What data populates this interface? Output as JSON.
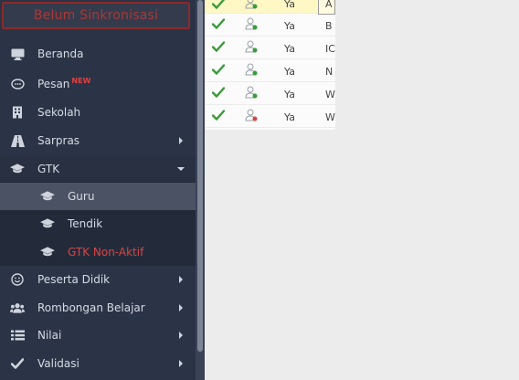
{
  "sync_status": "Belum Sinkronisasi",
  "menu": {
    "beranda": "Beranda",
    "pesan": "Pesan",
    "pesan_badge": "NEW",
    "sekolah": "Sekolah",
    "sarpras": "Sarpras",
    "gtk": "GTK",
    "guru": "Guru",
    "tendik": "Tendik",
    "gtk_nonaktif": "GTK Non-Aktif",
    "peserta_didik": "Peserta Didik",
    "rombongan_belajar": "Rombongan Belajar",
    "nilai": "Nilai",
    "validasi": "Validasi"
  },
  "table": {
    "rows": [
      {
        "status_icon": "check-icon",
        "user_icon": "user-active-icon",
        "answer": "Ya",
        "name_prefix": "A"
      },
      {
        "status_icon": "check-icon",
        "user_icon": "user-active-icon",
        "answer": "Ya",
        "name_prefix": "B"
      },
      {
        "status_icon": "check-icon",
        "user_icon": "user-active-icon",
        "answer": "Ya",
        "name_prefix": "IC"
      },
      {
        "status_icon": "check-icon",
        "user_icon": "user-active-icon",
        "answer": "Ya",
        "name_prefix": "N"
      },
      {
        "status_icon": "check-icon",
        "user_icon": "user-active-icon",
        "answer": "Ya",
        "name_prefix": "W"
      },
      {
        "status_icon": "check-icon",
        "user_icon": "user-inactive-icon",
        "answer": "Ya",
        "name_prefix": "W"
      }
    ]
  },
  "colors": {
    "sidebar_bg": "#2b3447",
    "sync_text": "#a83838",
    "nonaktif_text": "#d64545",
    "check": "#3a9a3a"
  }
}
